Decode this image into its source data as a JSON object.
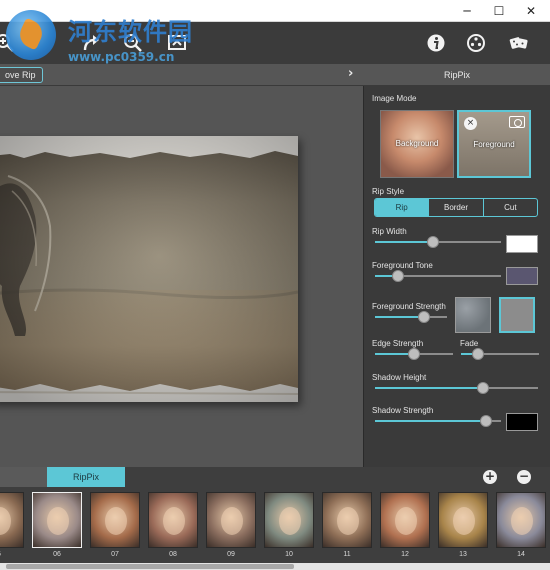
{
  "window": {
    "minimize": "─",
    "maximize": "☐",
    "close": "✕"
  },
  "watermark": {
    "title": "河东软件园",
    "url": "www.pc0359.cn"
  },
  "toolbar": {
    "icons": [
      "zoom-in-icon",
      "redo-icon",
      "zoom-out-icon",
      "fit-screen-icon",
      "info-icon",
      "settings-icon",
      "dice-icon"
    ]
  },
  "subbar": {
    "remove_rip": "ove Rip",
    "chevron": "›",
    "panel_title": "RipPix"
  },
  "panel": {
    "image_mode_label": "Image Mode",
    "background_label": "Background",
    "foreground_label": "Foreground",
    "rip_style_label": "Rip Style",
    "rip_style_options": [
      "Rip",
      "Border",
      "Cut"
    ],
    "rip_style_selected": "Rip",
    "rip_width_label": "Rip Width",
    "rip_width_value": 0.46,
    "rip_width_color": "#ffffff",
    "foreground_tone_label": "Foreground Tone",
    "foreground_tone_value": 0.18,
    "foreground_tone_color": "#5a5670",
    "foreground_strength_label": "Foreground Strength",
    "foreground_strength_value": 0.68,
    "edge_strength_label": "Edge Strength",
    "edge_strength_value": 0.5,
    "fade_label": "Fade",
    "fade_value": 0.22,
    "shadow_height_label": "Shadow Height",
    "shadow_height_value": 0.66,
    "shadow_strength_label": "Shadow Strength",
    "shadow_strength_value": 0.88,
    "shadow_strength_color": "#000000"
  },
  "bottom": {
    "tab_label": "RipPix",
    "add": "+",
    "remove": "−",
    "thumbnails": [
      {
        "num": "5",
        "tint": "#8a6a52"
      },
      {
        "num": "06",
        "tint": "#9a8a88"
      },
      {
        "num": "07",
        "tint": "#a46b4a"
      },
      {
        "num": "08",
        "tint": "#9a6a58"
      },
      {
        "num": "09",
        "tint": "#8a6d5e"
      },
      {
        "num": "10",
        "tint": "#7f8a80"
      },
      {
        "num": "11",
        "tint": "#8e6e56"
      },
      {
        "num": "12",
        "tint": "#b07050"
      },
      {
        "num": "13",
        "tint": "#a8844a"
      },
      {
        "num": "14",
        "tint": "#8a8a9a"
      }
    ],
    "selected_thumbnail": "06"
  }
}
